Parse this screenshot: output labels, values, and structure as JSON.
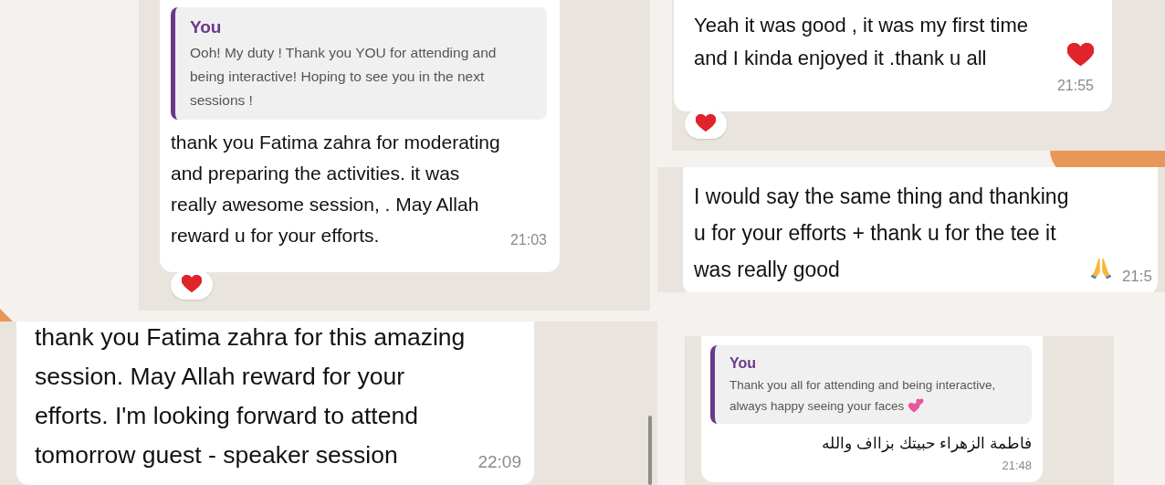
{
  "panels": [
    {
      "quote": {
        "author": "You",
        "text": "Ooh! My duty ! Thank you YOU for attending and being interactive! Hoping to see you in the next sessions !"
      },
      "text": "thank you Fatima zahra  for moderating and preparing the activities. it was really awesome session, . May Allah reward u for  your efforts.",
      "time": "21:03",
      "reacted": true
    },
    {
      "text": "Yeah it was good , it was my first time and I kinda enjoyed it .thank u all",
      "trailing_emoji": {
        "kind": "heart"
      },
      "time": "21:55",
      "reacted": true
    },
    {
      "text": "I would say the same thing and thanking u for your efforts + thank u for the tee it was really good",
      "trailing_emoji": {
        "kind": "pray"
      },
      "time": "21:5"
    },
    {
      "text": "thank you  Fatima zahra for this amazing session. May Allah reward for your efforts. I'm looking forward to attend tomorrow guest - speaker session",
      "time": "22:09"
    },
    {
      "quote": {
        "author": "You",
        "text": "Thank you all for attending and being interactive, always happy seeing your faces",
        "trailing_emoji": {
          "kind": "two-hearts"
        }
      },
      "text": "فاطمة الزهراء حبيتك بزااف والله",
      "time": "21:48"
    }
  ]
}
